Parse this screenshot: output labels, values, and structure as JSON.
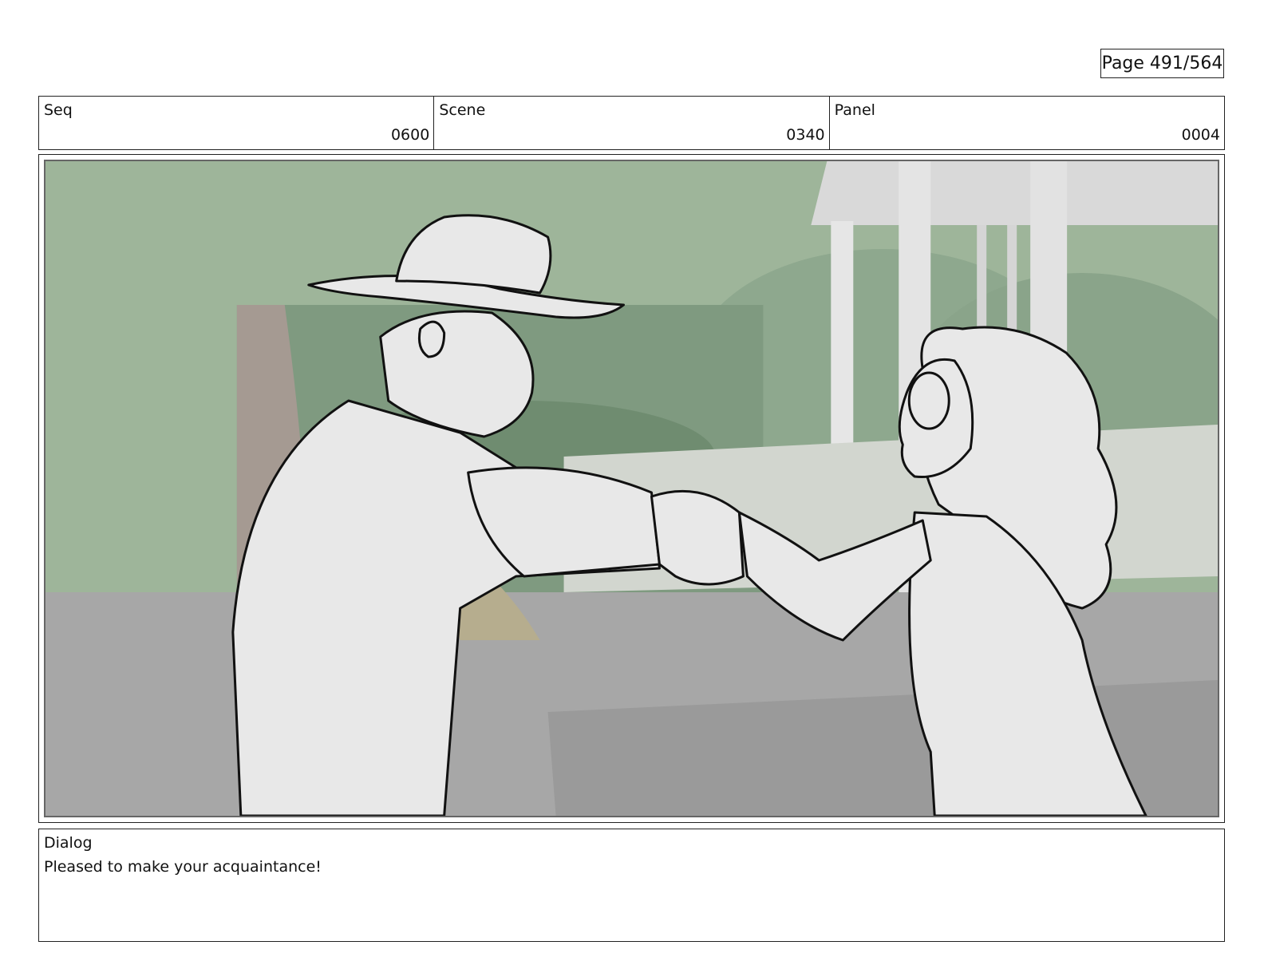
{
  "page": {
    "label": "Page 491/564"
  },
  "info": {
    "seq_label": "Seq",
    "seq_value": "0600",
    "scene_label": "Scene",
    "scene_value": "0340",
    "panel_label": "Panel",
    "panel_value": "0004"
  },
  "dialog": {
    "label": "Dialog",
    "text": "Pleased to make your acquaintance!"
  },
  "colors": {
    "sky": "#9eb59a",
    "wall": "#7f9a80",
    "ground": "#a7a7a7",
    "pillar": "#e6e6e6",
    "figure_fill": "#e8e8e8",
    "ink": "#111111"
  }
}
